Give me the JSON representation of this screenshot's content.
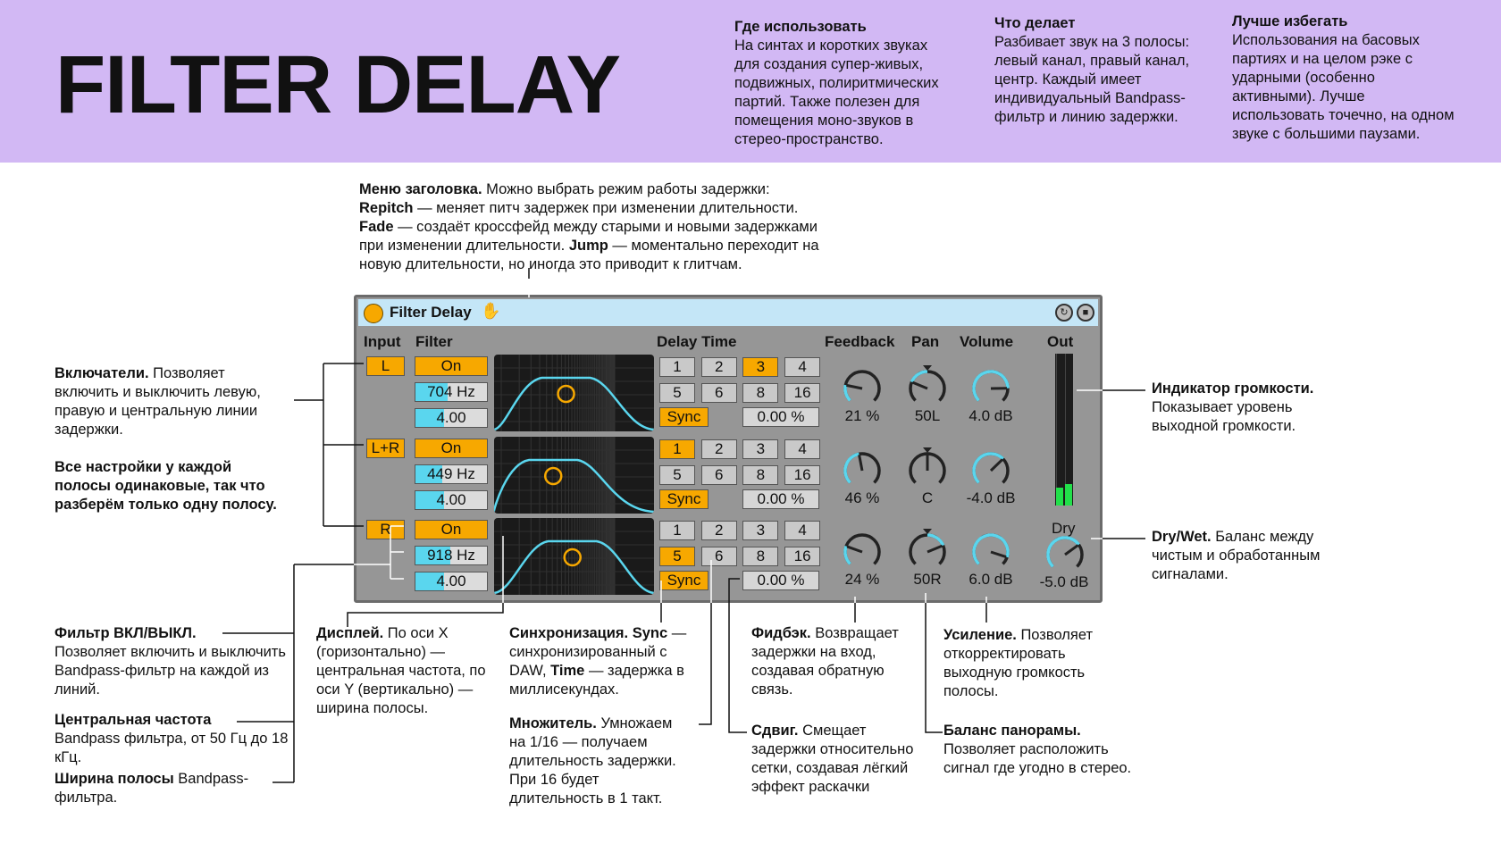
{
  "banner": {
    "title": "FILTER DELAY",
    "columns": [
      {
        "heading": "Где использовать",
        "lines": [
          "На синтах и коротких звуках",
          "для создания супер-живых,",
          "подвижных, полиритмических",
          "партий. Также полезен для",
          "помещения моно-звуков в",
          "стерео-пространство."
        ]
      },
      {
        "heading": "Что делает",
        "lines": [
          "Разбивает звук на 3 полосы:",
          "левый канал, правый канал,",
          "центр. Каждый имеет",
          "индивидуальный Bandpass-",
          "фильтр и линию задержки."
        ]
      },
      {
        "heading": "Лучше избегать",
        "lines": [
          "Использования на басовых",
          "партиях и на целом рэке с",
          "ударными (особенно",
          "активными). Лучше",
          "использовать точечно, на одном",
          "звуке с большими паузами."
        ]
      }
    ]
  },
  "device": {
    "name": "Filter Delay",
    "headers": {
      "input": "Input",
      "filter": "Filter",
      "delay_time": "Delay Time",
      "feedback": "Feedback",
      "pan": "Pan",
      "volume": "Volume",
      "out": "Out",
      "dry": "Dry"
    },
    "dry_value": "-5.0 dB",
    "dry_level": 0.7,
    "meter_levels": [
      0.12,
      0.14
    ],
    "colors": {
      "accent": "#f7a800",
      "cyan": "#5ad6ee",
      "titlebar": "#c4e6f7",
      "panel": "#969696"
    },
    "delay_buttons": [
      "1",
      "2",
      "3",
      "4",
      "5",
      "6",
      "8",
      "16"
    ],
    "sync_label": "Sync",
    "rows": [
      {
        "input": "L",
        "filter": "On",
        "freq": "704 Hz",
        "freq_level": 0.45,
        "width": "4.00",
        "width_level": 0.4,
        "delay_selected": "3",
        "offset": "0.00 %",
        "feedback": "21 %",
        "feedback_level": 0.21,
        "pan": "50L",
        "pan_level": -0.5,
        "volume": "4.0 dB",
        "volume_level": 0.83
      },
      {
        "input": "L+R",
        "filter": "On",
        "freq": "449 Hz",
        "freq_level": 0.37,
        "width": "4.00",
        "width_level": 0.4,
        "delay_selected": "1",
        "offset": "0.00 %",
        "feedback": "46 %",
        "feedback_level": 0.46,
        "pan": "C",
        "pan_level": 0,
        "volume": "-4.0 dB",
        "volume_level": 0.67
      },
      {
        "input": "R",
        "filter": "On",
        "freq": "918 Hz",
        "freq_level": 0.49,
        "width": "4.00",
        "width_level": 0.4,
        "delay_selected": "5",
        "offset": "0.00 %",
        "feedback": "24 %",
        "feedback_level": 0.24,
        "pan": "50R",
        "pan_level": 0.5,
        "volume": "6.0 dB",
        "volume_level": 0.9
      }
    ]
  },
  "annotations": {
    "header_menu": {
      "bold": "Меню заголовка.",
      "lines": [
        " Можно выбрать режим работы задержки:"
      ],
      "repitch_b": "Repitch",
      "repitch": " — меняет питч задержек при изменении длительности.",
      "fade_b": "Fade",
      "fade": " — создаёт кроссфейд между старыми и новыми задержками",
      "jump_pre": "при изменении длительности. ",
      "jump_b": "Jump",
      "jump": " — моментально переходит на",
      "last": "новую длительности, но иногда это приводит к глитчам."
    },
    "switches": {
      "bold": "Включатели.",
      "text": " Позволяет включить и выключить левую, правую и центральную линии задержки."
    },
    "same": {
      "bold": "Все настройки у каждой полосы одинаковые, так что разберём только одну полосу."
    },
    "filter_onoff": {
      "bold": "Фильтр ВКЛ/ВЫКЛ.",
      "text": "Позволяет включить и выключить Bandpass-фильтр на каждой из линий."
    },
    "center_freq": {
      "bold": "Центральная частота",
      "text": "Bandpass фильтра, от 50 Гц до 18 кГц."
    },
    "bandwidth": {
      "bold": "Ширина полосы",
      "text": " Bandpass-фильтра."
    },
    "display": {
      "bold": "Дисплей.",
      "text": " По оси X (горизонтально) — центральная частота, по оси Y (вертикально) — ширина полосы."
    },
    "sync": {
      "bold": "Синхронизация. Sync",
      "text1": " — синхронизированный с DAW, ",
      "bold2": "Time",
      "text2": " — задержка в миллисекундах."
    },
    "multiplier": {
      "bold": "Множитель.",
      "text": " Умножаем на 1/16 — получаем длительность задержки. При 16 будет длительность в 1 такт."
    },
    "feedback": {
      "bold": "Фидбэк.",
      "text": " Возвращает задержки на вход, создавая обратную связь."
    },
    "shift": {
      "bold": "Сдвиг.",
      "text": " Смещает задержки относительно сетки, создавая лёгкий эффект раскачки"
    },
    "gain": {
      "bold": "Усиление.",
      "text": " Позволяет откорректировать выходную громкость полосы."
    },
    "pan": {
      "bold": "Баланс панорамы.",
      "text": " Позволяет расположить сигнал где угодно в стерео."
    },
    "meter": {
      "bold": "Индикатор громкости.",
      "text": " Показывает уровень выходной громкости."
    },
    "drywet": {
      "bold": "Dry/Wet.",
      "text": " Баланс между чистым и обработанным сигналами."
    }
  }
}
